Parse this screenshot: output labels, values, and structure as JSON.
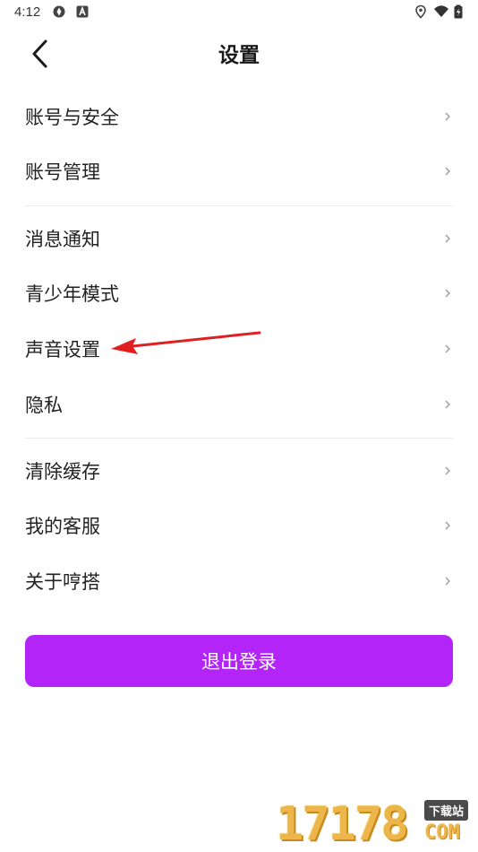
{
  "status_bar": {
    "time": "4:12",
    "icons": [
      "sync-icon",
      "app-a-icon",
      "location-icon",
      "wifi-icon",
      "battery-icon"
    ]
  },
  "header": {
    "title": "设置",
    "back_icon": "chevron-left-icon"
  },
  "menu": {
    "items": [
      {
        "label": "账号与安全"
      },
      {
        "label": "账号管理"
      },
      {
        "label": "消息通知"
      },
      {
        "label": "青少年模式"
      },
      {
        "label": "声音设置"
      },
      {
        "label": "隐私"
      },
      {
        "label": "清除缓存"
      },
      {
        "label": "我的客服"
      },
      {
        "label": "关于哼搭"
      }
    ],
    "chevron_icon": "chevron-right-icon"
  },
  "logout": {
    "label": "退出登录",
    "color": "#b224f7"
  },
  "annotation": {
    "arrow_color": "#e02020"
  },
  "watermark": {
    "main": "17178",
    "tag": "下载站",
    "suffix": "COM"
  }
}
